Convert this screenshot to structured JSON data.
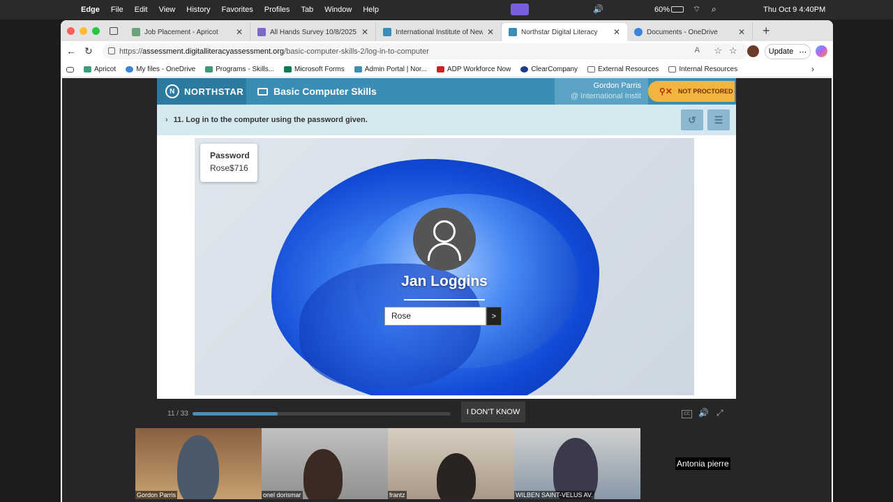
{
  "menubar": {
    "app": "Edge",
    "items": [
      "File",
      "Edit",
      "View",
      "History",
      "Favorites",
      "Profiles",
      "Tab",
      "Window",
      "Help"
    ],
    "battery": "60%",
    "clock": "Thu Oct 9  4:40PM"
  },
  "tabs": [
    {
      "label": "Job Placement - Apricot",
      "color": "#6ca37a"
    },
    {
      "label": "All Hands Survey 10/8/2025",
      "color": "#7b68c8"
    },
    {
      "label": "International Institute of New E",
      "color": "#3b8db3"
    },
    {
      "label": "Northstar Digital Literacy",
      "color": "#3b8db3",
      "active": true
    },
    {
      "label": "Documents - OneDrive",
      "color": "#3a84d9"
    }
  ],
  "address": {
    "prefix": "https://",
    "host": "assessment.digitalliteracyassessment.org",
    "path": "/basic-computer-skills-2/log-in-to-computer",
    "update": "Update"
  },
  "favorites": [
    {
      "label": "Apricot",
      "color": "#3aa07a"
    },
    {
      "label": "My files - OneDrive",
      "color": "#3a84d9"
    },
    {
      "label": "Programs - Skills...",
      "color": "#3a9a7a"
    },
    {
      "label": "Microsoft Forms",
      "color": "#0b7a55"
    },
    {
      "label": "Admin Portal | Nor...",
      "color": "#3b8db3"
    },
    {
      "label": "ADP Workforce Now",
      "color": "#d42020"
    },
    {
      "label": "ClearCompany",
      "color": "#1a3a8a"
    },
    {
      "label": "External Resources",
      "color": "#888"
    },
    {
      "label": "Internal Resources",
      "color": "#888"
    }
  ],
  "northstar": {
    "brand": "NORTHSTAR",
    "module": "Basic Computer Skills",
    "user": "Gordon Parris",
    "org": "@ International Instit",
    "proctor": "NOT PROCTORED",
    "question": "11. Log in to the computer using the password given.",
    "password_label": "Password",
    "password_value": "Rose$716",
    "login_name": "Jan Loggins",
    "input_value": "Rose",
    "go": ">",
    "counter": "11 / 33",
    "progress": 0.33,
    "idk": "I DON'T KNOW",
    "cc": "CC"
  },
  "participants": [
    "Gordon Parris",
    "onel dorismar",
    "frantz",
    "WILBEN SAINT-VELUS AV.",
    "Antonia pierre"
  ]
}
